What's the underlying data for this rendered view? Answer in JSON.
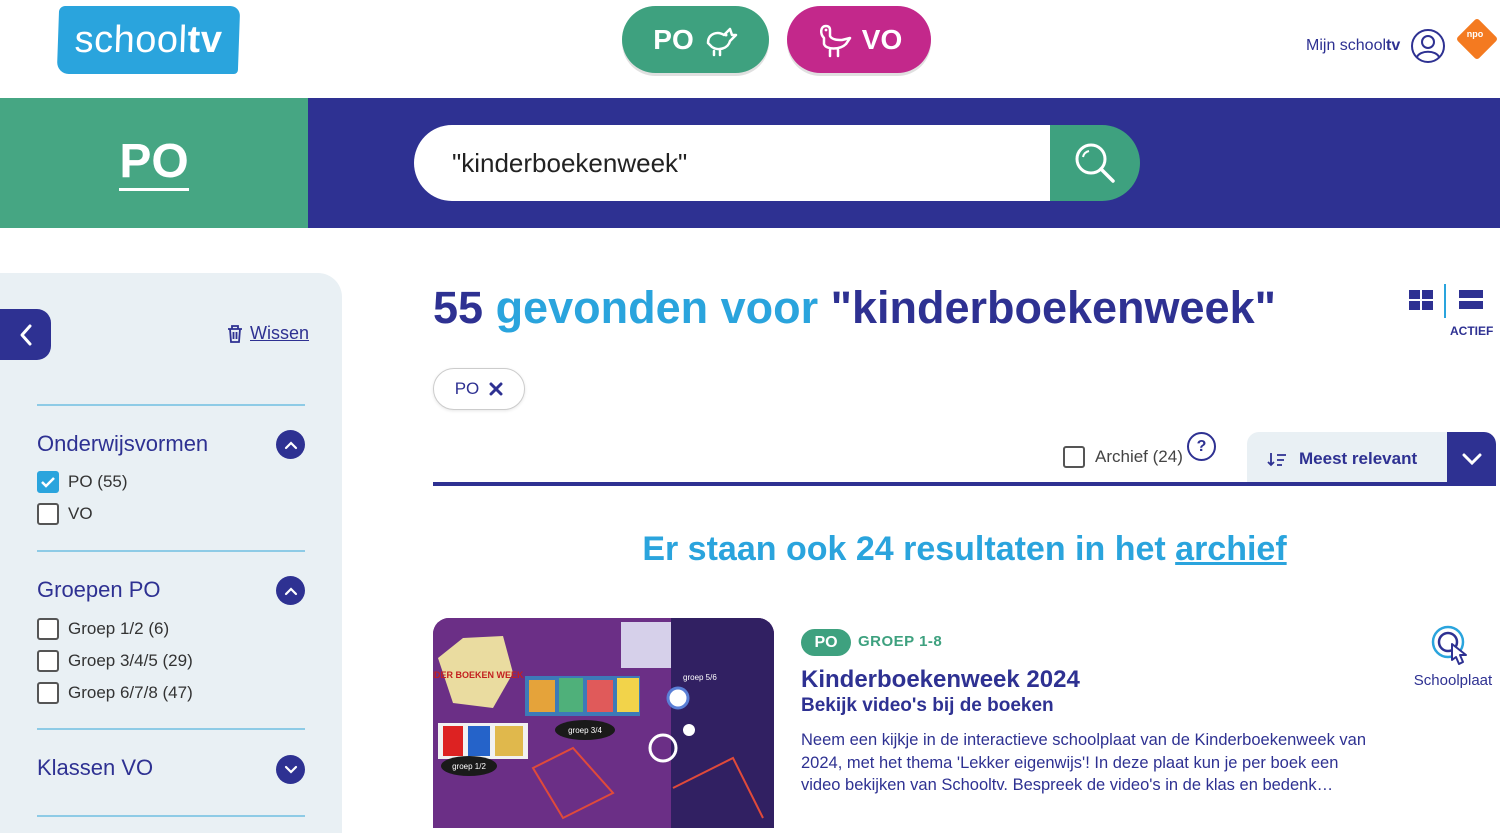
{
  "header": {
    "logo_prefix": "school",
    "logo_suffix": "tv",
    "levels": [
      {
        "label": "PO"
      },
      {
        "label": "VO"
      }
    ],
    "account_prefix": "Mijn school",
    "account_suffix": "tv",
    "npo_label": "npo"
  },
  "band": {
    "level_title": "PO",
    "search_value": "\"kinderboekenweek\""
  },
  "sidebar": {
    "clear_label": "Wissen",
    "groups": [
      {
        "title": "Onderwijsvormen",
        "options": [
          {
            "label": "PO (55)",
            "checked": true
          },
          {
            "label": "VO",
            "checked": false
          }
        ]
      },
      {
        "title": "Groepen PO",
        "options": [
          {
            "label": "Groep 1/2 (6)",
            "checked": false
          },
          {
            "label": "Groep 3/4/5 (29)",
            "checked": false
          },
          {
            "label": "Groep 6/7/8 (47)",
            "checked": false
          }
        ]
      },
      {
        "title": "Klassen VO",
        "options": []
      }
    ]
  },
  "results": {
    "count": "55",
    "found_text": " gevonden voor ",
    "query": "\"kinderboekenweek\"",
    "view_active_label": "ACTIEF",
    "active_filter": "PO",
    "archive_checkbox_label": "Archief (24)",
    "help_label": "?",
    "sort_label": "Meest relevant",
    "archive_note_prefix": "Er staan ook 24 resultaten in het ",
    "archive_note_link": "archief"
  },
  "card": {
    "badge": "PO",
    "groep": "GROEP 1-8",
    "title": "Kinderboekenweek 2024",
    "subtitle": "Bekijk video's bij de boeken",
    "description": "Neem een kijkje in de interactieve schoolplaat van de Kinderboekenweek van 2024, met het thema 'Lekker eigenwijs'! In deze plaat kun je per boek een video bekijken van Schooltv. Bespreek de video's in de klas en bedenk…",
    "type_label": "Schoolplaat",
    "thumb_labels": [
      "KINDER BOEKEN WEEK",
      "groep 1/2",
      "groep 3/4",
      "groep 5/6"
    ]
  },
  "colors": {
    "navy": "#2e3192",
    "green": "#3ea17f",
    "magenta": "#c3288b",
    "sky": "#2aa4dd",
    "panel": "#e9f0f4"
  }
}
